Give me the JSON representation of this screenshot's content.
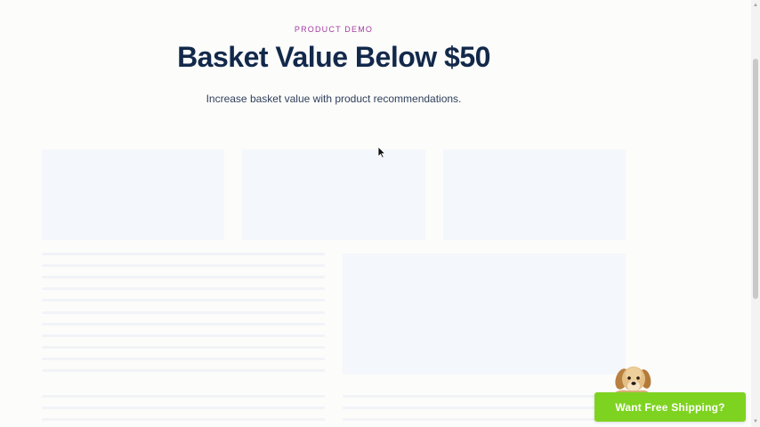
{
  "hero": {
    "eyebrow": "PRODUCT DEMO",
    "title": "Basket Value Below $50",
    "subtitle": "Increase basket value with product recommendations."
  },
  "widget": {
    "button_label": "Want Free Shipping?",
    "mascot_icon": "puppy-icon",
    "button_color": "#7ed321"
  },
  "colors": {
    "title": "#13294b",
    "eyebrow": "#a23b9f",
    "placeholder": "#f4f7fb"
  },
  "icons": {
    "cursor": "pointer-cursor-icon",
    "scroll_up": "chevron-up-icon",
    "scroll_down": "chevron-down-icon"
  }
}
